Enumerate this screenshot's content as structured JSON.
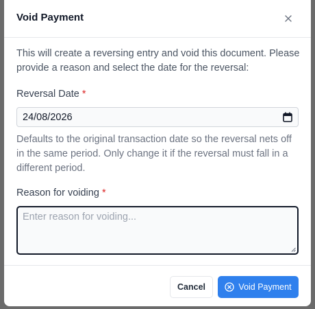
{
  "dialog": {
    "title": "Void Payment",
    "close_icon": "close-icon",
    "description": "This will create a reversing entry and void this document. Please provide a reason and select the date for the reversal:",
    "reversal_date": {
      "label": "Reversal Date",
      "required_mark": "*",
      "value": "24/08/2026",
      "icon": "calendar-icon",
      "help": "Defaults to the original transaction date so the reversal nets off in the same period. Only change it if the reversal must fall in a different period."
    },
    "reason": {
      "label": "Reason for voiding",
      "required_mark": "*",
      "placeholder": "Enter reason for voiding..."
    },
    "footer": {
      "cancel_label": "Cancel",
      "void_label": "Void Payment",
      "void_icon": "x-circle-icon"
    }
  },
  "colors": {
    "primary": "#2f80ed",
    "required": "#dc2626"
  }
}
